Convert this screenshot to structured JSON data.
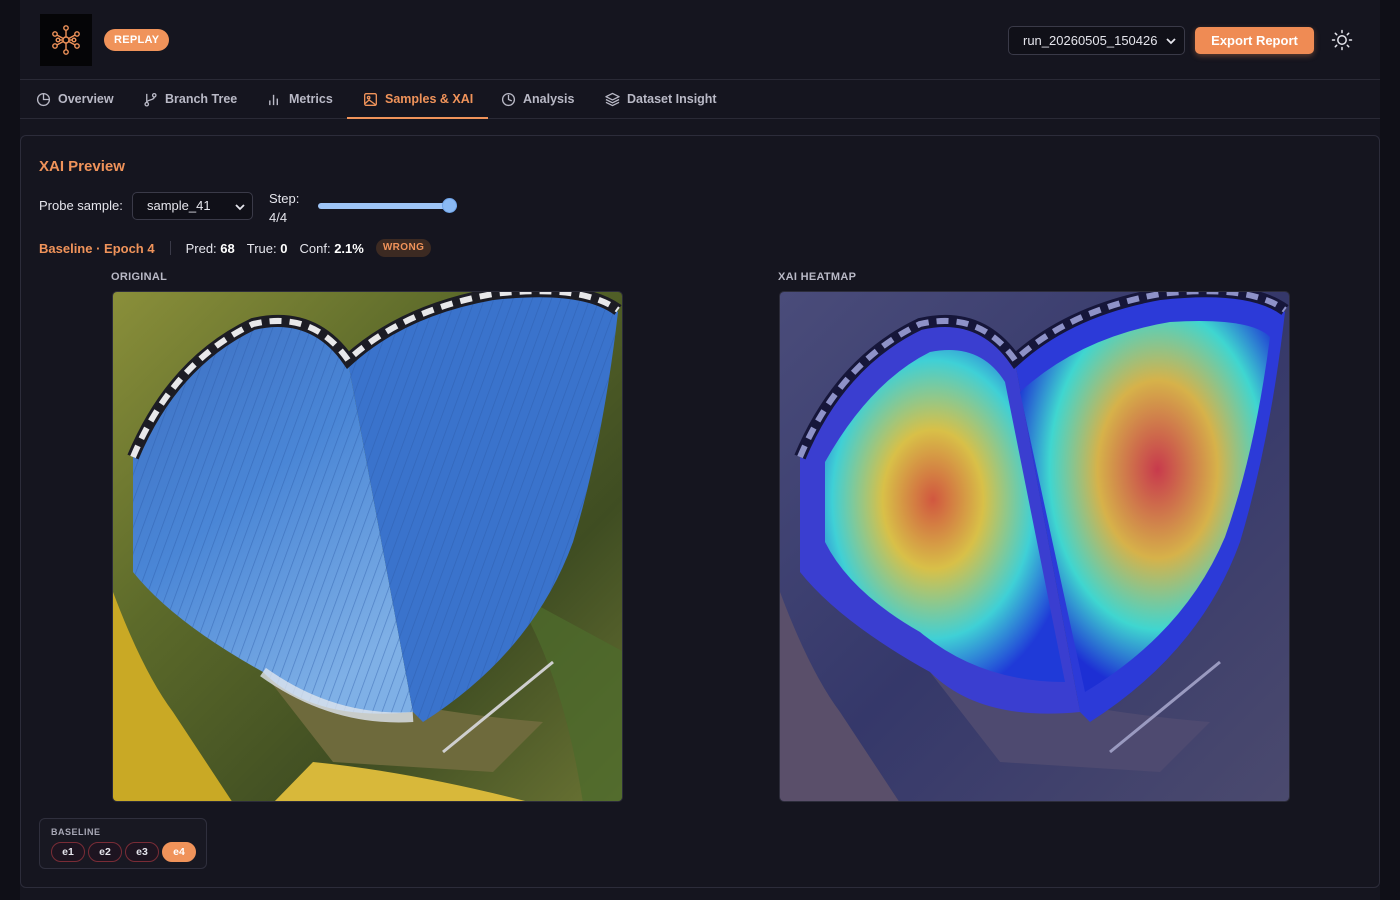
{
  "header": {
    "mode_badge": "REPLAY",
    "run_select_value": "run_20260505_150426",
    "export_label": "Export Report"
  },
  "tabs": [
    {
      "label": "Overview",
      "icon": "pie-chart-icon"
    },
    {
      "label": "Branch Tree",
      "icon": "git-branch-icon"
    },
    {
      "label": "Metrics",
      "icon": "bar-chart-icon"
    },
    {
      "label": "Samples & XAI",
      "icon": "image-icon",
      "active": true
    },
    {
      "label": "Analysis",
      "icon": "analysis-icon"
    },
    {
      "label": "Dataset Insight",
      "icon": "layers-icon"
    }
  ],
  "xai": {
    "title": "XAI Preview",
    "probe_label": "Probe sample:",
    "probe_value": "sample_41",
    "step_label": "Step:",
    "step_value": "4/4",
    "step_current": 4,
    "step_max": 4,
    "model_epoch": "Baseline · Epoch 4",
    "pred_label": "Pred:",
    "pred_value": "68",
    "true_label": "True:",
    "true_value": "0",
    "conf_label": "Conf:",
    "conf_value": "2.1%",
    "verdict": "WRONG",
    "original_label": "ORIGINAL",
    "heatmap_label": "XAI HEATMAP"
  },
  "epochs": {
    "group_label": "BASELINE",
    "items": [
      "e1",
      "e2",
      "e3",
      "e4"
    ],
    "active": "e4"
  },
  "colors": {
    "accent": "#f0935a",
    "background": "#15151f",
    "slider": "#9ec5f7"
  }
}
